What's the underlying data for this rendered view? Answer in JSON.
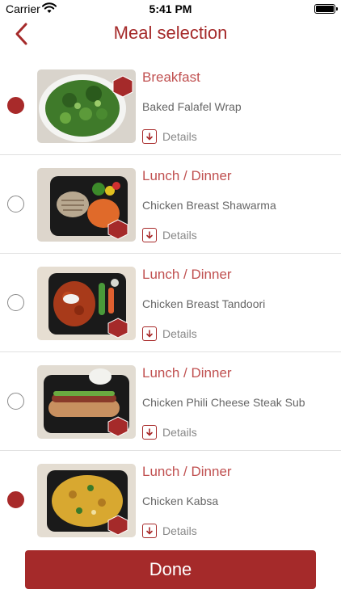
{
  "status_bar": {
    "carrier": "Carrier",
    "time": "5:41 PM"
  },
  "nav": {
    "title": "Meal selection"
  },
  "meals": [
    {
      "type": "Breakfast",
      "name": "Baked Falafel Wrap",
      "details_label": "Details",
      "selected": true
    },
    {
      "type": "Lunch / Dinner",
      "name": "Chicken Breast Shawarma",
      "details_label": "Details",
      "selected": false
    },
    {
      "type": "Lunch / Dinner",
      "name": "Chicken Breast Tandoori",
      "details_label": "Details",
      "selected": false
    },
    {
      "type": "Lunch / Dinner",
      "name": "Chicken Phili Cheese Steak Sub",
      "details_label": "Details",
      "selected": false
    },
    {
      "type": "Lunch / Dinner",
      "name": "Chicken Kabsa",
      "details_label": "Details",
      "selected": true
    }
  ],
  "done_label": "Done",
  "colors": {
    "accent": "#a52a2a",
    "type_text": "#c05050"
  }
}
